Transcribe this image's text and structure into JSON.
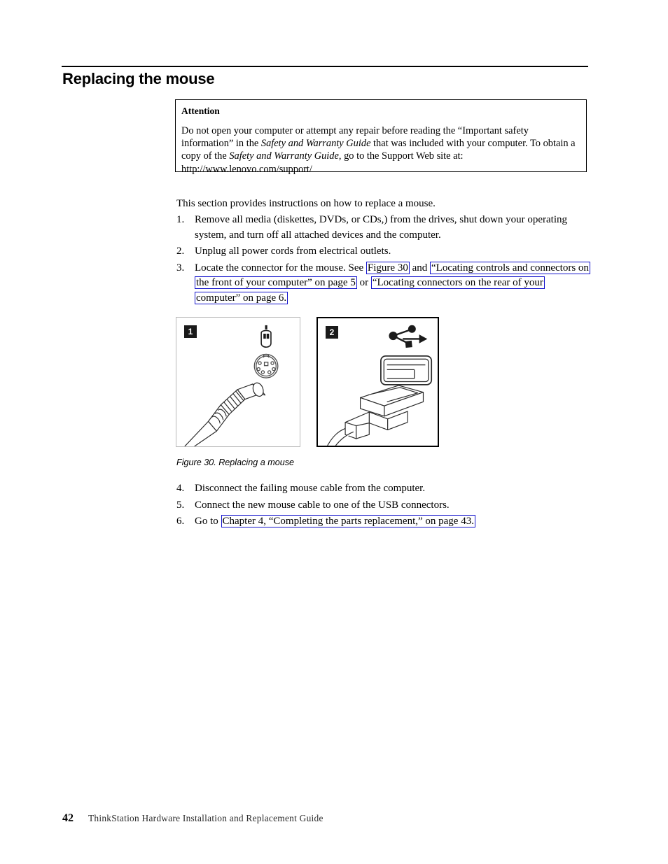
{
  "document": {
    "heading": "Replacing the mouse",
    "footer": {
      "page_number": "42",
      "title": "ThinkStation Hardware Installation and Replacement Guide"
    }
  },
  "attention": {
    "title": "Attention",
    "line1_a": "Do not open your computer or attempt any repair before reading the “Important safety information” in the ",
    "italic1": "Safety and Warranty Guide",
    "line1_b": " that was included with your computer. To obtain a copy of the ",
    "italic2": "Safety and Warranty Guide",
    "line1_c": ", go to the Support Web site at: http://www.lenovo.com/support/"
  },
  "intro": "This section provides instructions on how to replace a mouse.",
  "steps": [
    {
      "number": "1.",
      "text": "Remove all media (diskettes, DVDs, or CDs,) from the drives, shut down your operating system, and turn off all attached devices and the computer."
    },
    {
      "number": "2.",
      "text": "Unplug all power cords from electrical outlets."
    },
    {
      "number": "3.",
      "lead": "Locate the connector for the mouse. See ",
      "link1": "Figure 30",
      "mid1": " and ",
      "link2": "“Locating controls and connectors on the front of your computer” on page 5",
      "mid2": " or ",
      "link3": "“Locating connectors on the rear of your computer” on page 6.",
      "tail": ""
    },
    {
      "number": "4.",
      "text": "Disconnect the failing mouse cable from the computer."
    },
    {
      "number": "5.",
      "text": "Connect the new mouse cable to one of the USB connectors."
    },
    {
      "number": "6.",
      "lead": "Go to ",
      "link1": "Chapter 4, “Completing the parts replacement,” on page 43.",
      "tail": ""
    }
  ],
  "figure": {
    "caption": "Figure 30. Replacing a mouse",
    "panels": [
      {
        "badge": "1",
        "callout": "ps2-mouse-connector",
        "icons": [
          "mouse-icon",
          "ps2-port-icon"
        ],
        "illustration": "ps2-cable-plug"
      },
      {
        "badge": "2",
        "callout": "usb-mouse-connector",
        "icons": [
          "usb-trident-icon",
          "usb-port-icon"
        ],
        "illustration": "usb-cable-plug"
      }
    ]
  },
  "colors": {
    "link_border": "#1414cc",
    "rule": "#000000",
    "panel1_border": "#b9b9b9",
    "panel2_border": "#000000",
    "badge_bg": "#1a1a1a"
  }
}
